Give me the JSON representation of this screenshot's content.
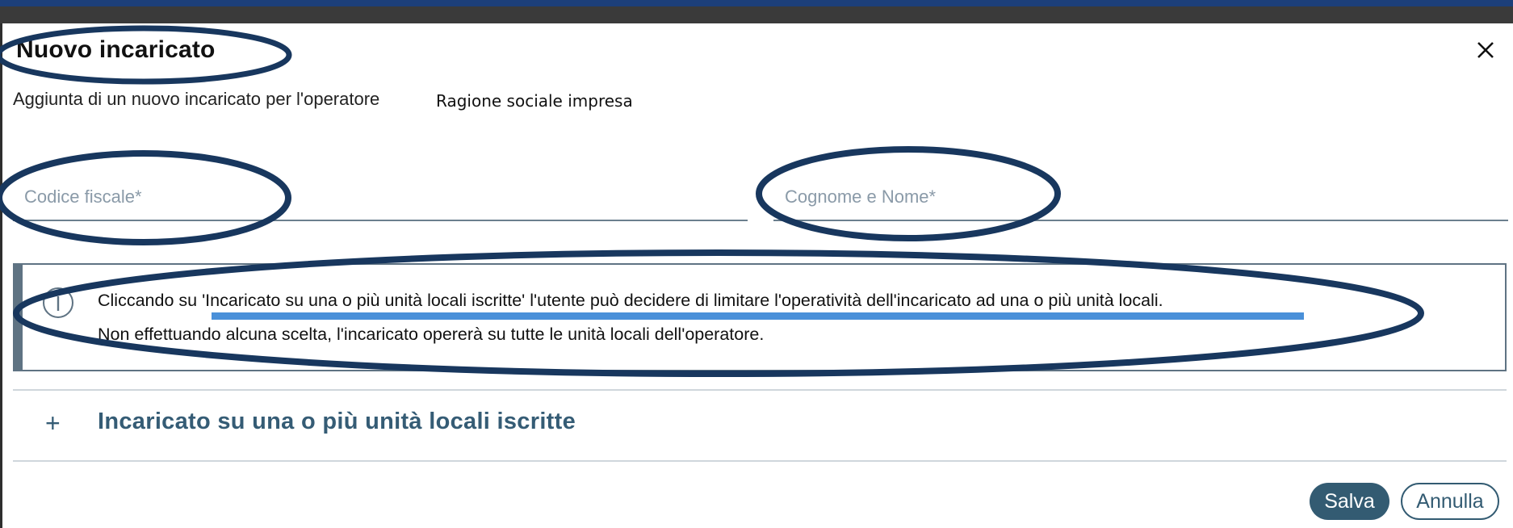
{
  "dialog": {
    "title": "Nuovo incaricato",
    "subtitle": "Aggiunta di un nuovo incaricato per l'operatore",
    "company_name": "Ragione sociale impresa",
    "close_icon": "close-icon"
  },
  "form": {
    "codice_fiscale": {
      "value": "",
      "placeholder": "Codice fiscale*"
    },
    "cognome_nome": {
      "value": "",
      "placeholder": "Cognome e Nome*"
    }
  },
  "info": {
    "icon": "info-icon",
    "line1": "Cliccando su 'Incaricato su una o più unità locali iscritte' l'utente può decidere di limitare l'operatività dell'incaricato ad una o più unità locali.",
    "line2": "Non effettuando alcuna scelta, l'incaricato opererà su tutte le unità locali dell'operatore."
  },
  "accordion": {
    "icon": "plus-icon",
    "label": "Incaricato su una o più unità locali iscritte"
  },
  "actions": {
    "save_label": "Salva",
    "cancel_label": "Annulla"
  },
  "colors": {
    "accent": "#335b72",
    "annotation_outline": "#18375e",
    "annotation_underline": "#4a90d9"
  }
}
